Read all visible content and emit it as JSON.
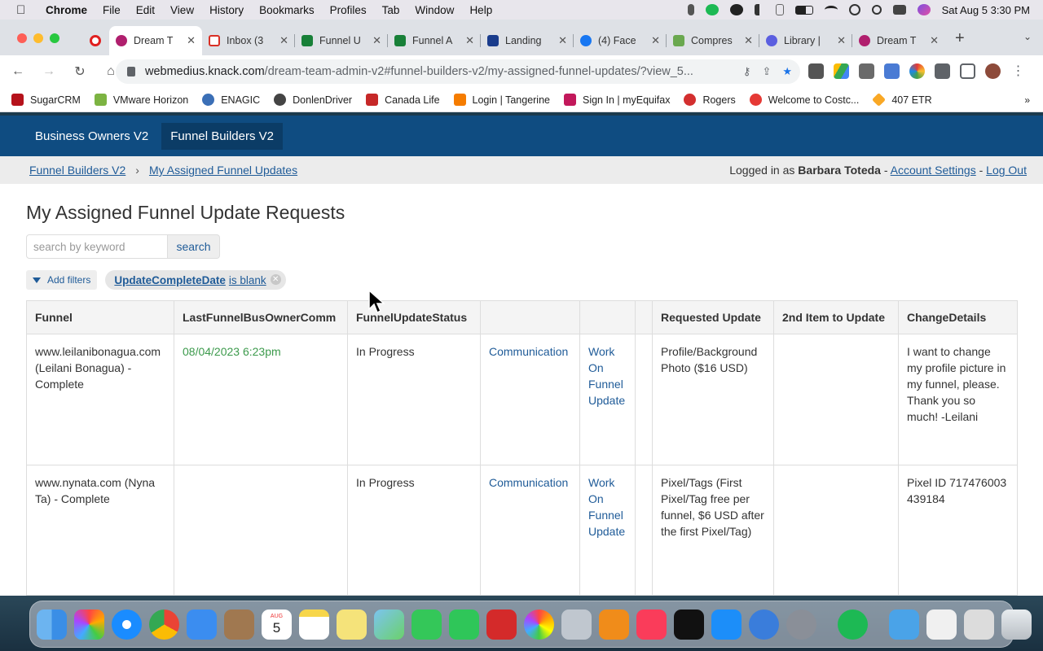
{
  "menubar": {
    "app_name": "Chrome",
    "items": [
      "File",
      "Edit",
      "View",
      "History",
      "Bookmarks",
      "Profiles",
      "Tab",
      "Window",
      "Help"
    ],
    "clock": "Sat Aug 5  3:30 PM"
  },
  "tabs": [
    {
      "label": "Dream T",
      "icon": "knack-icon",
      "color": "#b01f6e",
      "active": true
    },
    {
      "label": "Inbox (3",
      "icon": "gmail-icon",
      "color": "#d93025",
      "active": false
    },
    {
      "label": "Funnel U",
      "icon": "sheets-icon",
      "color": "#188038",
      "active": false
    },
    {
      "label": "Funnel A",
      "icon": "sheets-icon",
      "color": "#188038",
      "active": false
    },
    {
      "label": "Landing",
      "icon": "landing-icon",
      "color": "#1a3c8c",
      "active": false
    },
    {
      "label": "(4) Face",
      "icon": "facebook-icon",
      "color": "#1877f2",
      "active": false
    },
    {
      "label": "Compres",
      "icon": "compress-icon",
      "color": "#6aa84f",
      "active": false
    },
    {
      "label": "Library |",
      "icon": "library-icon",
      "color": "#5b5fe0",
      "active": false
    },
    {
      "label": "Dream T",
      "icon": "knack-icon",
      "color": "#b01f6e",
      "active": false
    }
  ],
  "address": {
    "host": "webmedius.knack.com",
    "path": "/dream-team-admin-v2#funnel-builders-v2/my-assigned-funnel-updates/?view_5..."
  },
  "bookmarks": [
    {
      "label": "SugarCRM",
      "color": "#b5121b"
    },
    {
      "label": "VMware Horizon",
      "color": "#7cb342"
    },
    {
      "label": "ENAGIC",
      "color": "#3b6fb6"
    },
    {
      "label": "DonlenDriver",
      "color": "#444444"
    },
    {
      "label": "Canada Life",
      "color": "#c62828"
    },
    {
      "label": "Login | Tangerine",
      "color": "#f57c00"
    },
    {
      "label": "Sign In | myEquifax",
      "color": "#c2185b"
    },
    {
      "label": "Rogers",
      "color": "#d32f2f"
    },
    {
      "label": "Welcome to Costc...",
      "color": "#e53935"
    },
    {
      "label": "407 ETR",
      "color": "#f9a825"
    }
  ],
  "app_nav": {
    "tab1": "Business Owners V2",
    "tab2": "Funnel Builders V2"
  },
  "breadcrumb": {
    "crumb1": "Funnel Builders V2",
    "crumb2": "My Assigned Funnel Updates",
    "logged_in_prefix": "Logged in as",
    "user": "Barbara Toteda",
    "dash": "-",
    "account_settings": "Account Settings",
    "logout": "Log Out"
  },
  "page_title": "My Assigned Funnel Update Requests",
  "search": {
    "placeholder": "search by keyword",
    "button": "search"
  },
  "filters": {
    "add_label": "Add filters",
    "chip_field": "UpdateCompleteDate",
    "chip_condition": "is blank"
  },
  "table": {
    "headers": [
      "Funnel",
      "LastFunnelBusOwnerComm",
      "FunnelUpdateStatus",
      "",
      "",
      "",
      "Requested Update",
      "2nd Item to Update",
      "ChangeDetails"
    ],
    "rows": [
      {
        "funnel": "www.leilanibonagua.com (Leilani Bonagua) - Complete",
        "last_comm": "08/04/2023 6:23pm",
        "status": "In Progress",
        "communication": "Communication",
        "work": "Work On Funnel Update",
        "requested": "Profile/Background Photo ($16 USD)",
        "second": "",
        "details": "I want to change my profile picture in my funnel, please. Thank you so much! -Leilani"
      },
      {
        "funnel": "www.nynata.com (Nyna Ta) - Complete",
        "last_comm": "",
        "status": "In Progress",
        "communication": "Communication",
        "work": "Work On Funnel Update",
        "requested": "Pixel/Tags (First Pixel/Tag free per funnel, $6 USD after the first Pixel/Tag)",
        "second": "",
        "details": "Pixel ID 717476003439184"
      }
    ]
  },
  "dock": {
    "calendar_month": "AUG",
    "calendar_day": "5"
  }
}
